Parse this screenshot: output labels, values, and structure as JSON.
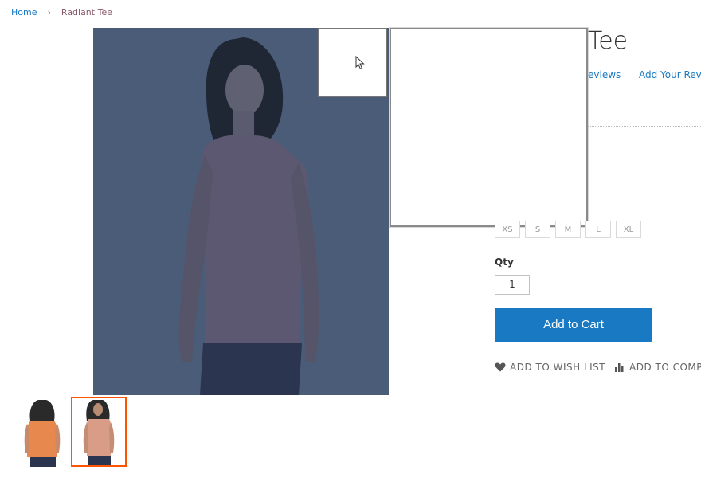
{
  "breadcrumb": {
    "home": "Home",
    "separator": "›",
    "current": "Radiant Tee"
  },
  "product": {
    "title_visible": "Tee",
    "reviews_label": "eviews",
    "add_review_label": "Add Your Revie",
    "sizes": [
      "XS",
      "S",
      "M",
      "L",
      "XL"
    ],
    "qty_label": "Qty",
    "qty_value": "1",
    "add_to_cart_label": "Add to Cart",
    "wishlist_label": "ADD TO WISH LIST",
    "compare_label": "ADD TO COMPA"
  },
  "colors": {
    "accent_blue": "#1979c3",
    "thumb_active_border": "#ff5501",
    "gallery_overlay": "#4a5c78"
  },
  "icons": {
    "cursor": "cursor-arrow-icon",
    "wishlist": "heart-icon",
    "compare": "bar-chart-icon"
  }
}
